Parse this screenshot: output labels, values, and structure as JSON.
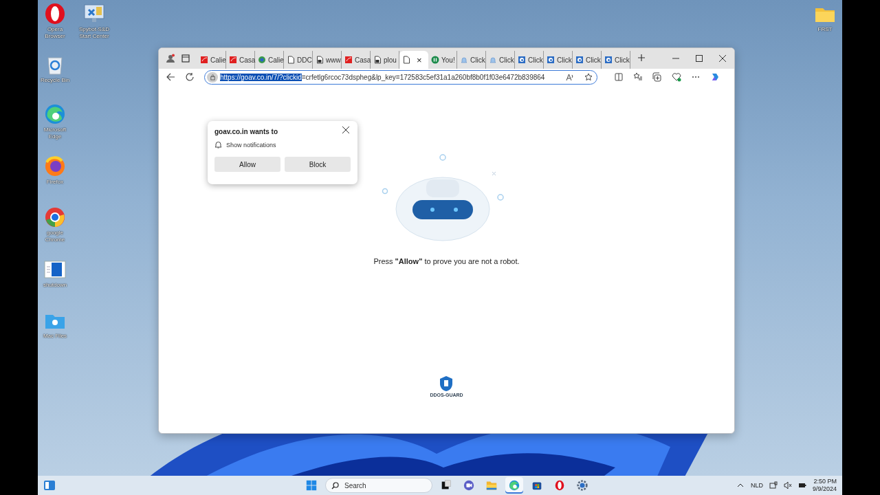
{
  "desktop": {
    "icons": [
      {
        "label": "Opera Browser",
        "kind": "opera"
      },
      {
        "label": "Recycle Bin",
        "kind": "recycle"
      },
      {
        "label": "Microsoft Edge",
        "kind": "edge"
      },
      {
        "label": "Firefox",
        "kind": "firefox"
      },
      {
        "label": "google Chrome",
        "kind": "chrome"
      },
      {
        "label": "shutdown",
        "kind": "shutdown"
      },
      {
        "label": "Mac Files",
        "kind": "folder-apple"
      }
    ],
    "second_column_icons": [
      {
        "label": "Spybot-S&D Start Center",
        "kind": "spybot"
      }
    ],
    "right_icons": [
      {
        "label": "FRST",
        "kind": "folder"
      }
    ]
  },
  "browser": {
    "tabs": [
      {
        "title": "Calie",
        "kind": "logo",
        "selected": false
      },
      {
        "title": "Casa",
        "kind": "logo",
        "selected": false
      },
      {
        "title": "Calie",
        "kind": "globe",
        "selected": false
      },
      {
        "title": "DDC",
        "kind": "page",
        "selected": false
      },
      {
        "title": "www",
        "kind": "lock-page",
        "selected": false
      },
      {
        "title": "Casa",
        "kind": "logo",
        "selected": false
      },
      {
        "title": "plou",
        "kind": "lock-page",
        "selected": false
      },
      {
        "kind": "page",
        "selected": true,
        "close": "×"
      },
      {
        "title": "You!",
        "kind": "circle-logo",
        "selected": false
      },
      {
        "title": "Click",
        "kind": "bell",
        "selected": false
      },
      {
        "title": "Click",
        "kind": "bell",
        "selected": false
      },
      {
        "title": "Click",
        "kind": "browser-logo",
        "selected": false
      },
      {
        "title": "Click",
        "kind": "browser-logo",
        "selected": false
      },
      {
        "title": "Click",
        "kind": "browser-logo",
        "selected": false
      },
      {
        "title": "Click",
        "kind": "browser-logo",
        "selected": false
      }
    ],
    "address": {
      "highlighted": "https://goav.co.in/7/?clickid",
      "rest": "=crfetlg6rcoc73dspheg&lp_key=172583c5ef31a1a260bf8b0f1f03e6472b839864"
    },
    "permission_popup": {
      "title": "goav.co.in wants to",
      "permission": "Show notifications",
      "buttons": [
        "Allow",
        "Block"
      ]
    },
    "page": {
      "message": "Press **\"Allow\"** to prove you are not a robot.",
      "badge_text": "DDOS-GUARD"
    }
  },
  "taskbar": {
    "search_placeholder": "Search",
    "apps": [
      {
        "kind": "task-view",
        "selected": false
      },
      {
        "kind": "chat",
        "selected": false
      },
      {
        "kind": "explorer",
        "selected": false
      },
      {
        "kind": "edge",
        "selected": true
      },
      {
        "kind": "store",
        "selected": false
      },
      {
        "kind": "opera",
        "selected": false
      },
      {
        "kind": "settings",
        "selected": false
      }
    ],
    "language": "NLD",
    "time": "2:50 PM",
    "date": "9/9/2024"
  }
}
